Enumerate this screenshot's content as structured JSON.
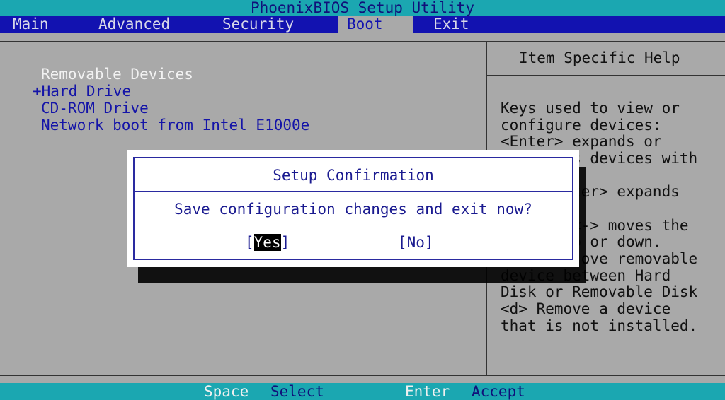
{
  "title": "PhoenixBIOS Setup Utility",
  "menu": {
    "tabs": [
      {
        "label": "Main"
      },
      {
        "label": "Advanced"
      },
      {
        "label": "Security"
      },
      {
        "label": "Boot",
        "active": true
      },
      {
        "label": "Exit"
      }
    ]
  },
  "boot": {
    "devices": [
      {
        "label": "Removable Devices",
        "prefix": ""
      },
      {
        "label": "Hard Drive",
        "prefix": "+"
      },
      {
        "label": "CD-ROM Drive",
        "prefix": ""
      },
      {
        "label": "Network boot from Intel E1000e",
        "prefix": ""
      }
    ]
  },
  "help": {
    "title": "Item Specific Help",
    "lines": [
      "Keys used to view or",
      "configure devices:",
      "<Enter> expands or",
      "        s devices with",
      "",
      "        ter> expands",
      "",
      "        <-> moves the",
      "        p or down.",
      "         ove removable",
      "device between Hard",
      "Disk or Removable Disk",
      "<d> Remove a device",
      "that is not installed."
    ]
  },
  "dialog": {
    "title": "Setup Confirmation",
    "message": "Save configuration changes and exit now?",
    "yes_open": "[",
    "yes_label": "Yes",
    "yes_close": "]",
    "no_label": "[No]"
  },
  "status": {
    "keys": [
      {
        "key": "Space",
        "action": "Select"
      },
      {
        "key": "Enter",
        "action": "Accept"
      }
    ]
  },
  "colors": {
    "teal": "#1ba7b1",
    "menu_blue": "#1212b0",
    "panel_gray": "#a9a9a9",
    "text_blue": "#1414a8"
  }
}
